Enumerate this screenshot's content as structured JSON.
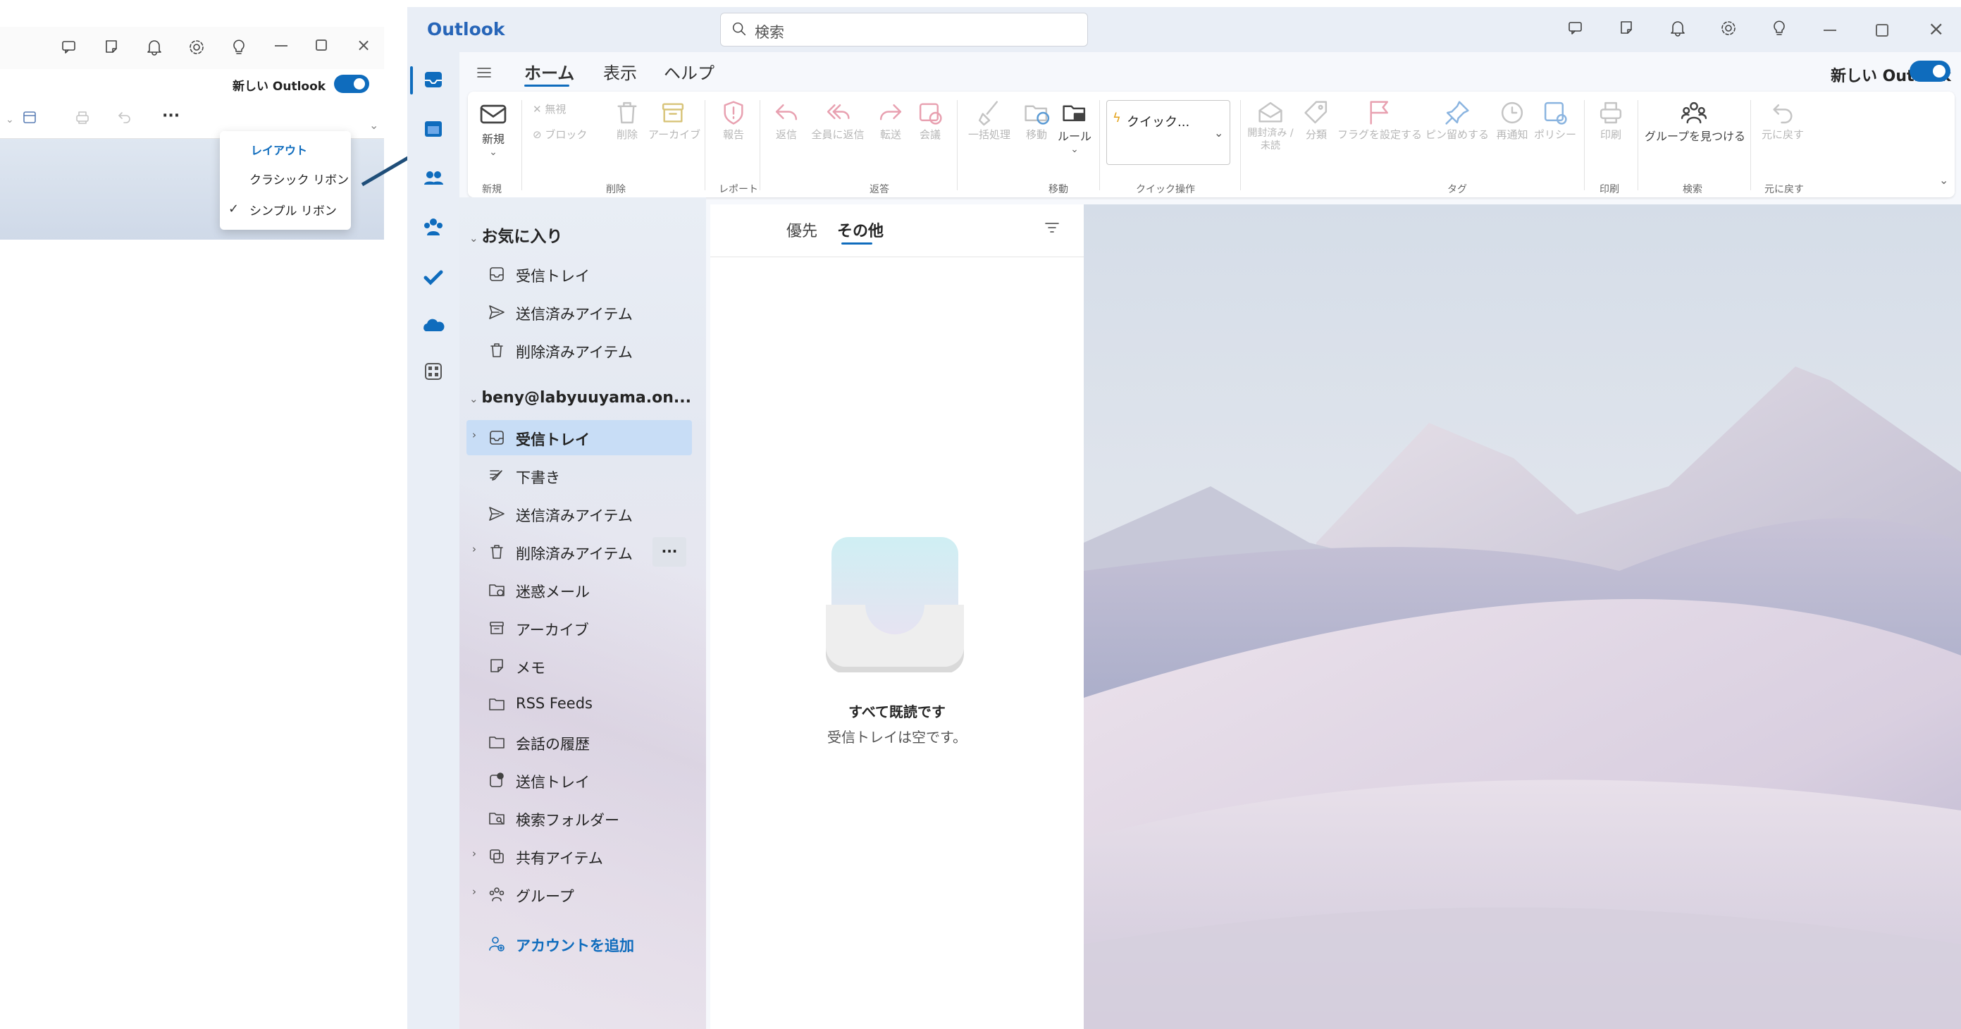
{
  "inset": {
    "toggle_label": "新しい Outlook",
    "more": "···",
    "menu": {
      "header": "レイアウト",
      "items": [
        "クラシック リボン",
        "シンプル リボン"
      ],
      "checked": "シンプル リボン"
    }
  },
  "window": {
    "app_title": "Outlook",
    "search_placeholder": "検索",
    "toggle_label": "新しい Outlook",
    "tabs": [
      "ホーム",
      "表示",
      "ヘルプ"
    ],
    "active_tab": "ホーム"
  },
  "ribbon": {
    "new": "新規",
    "ignore": "無視",
    "block": "ブロック",
    "delete": "削除",
    "archive": "アーカイブ",
    "report": "報告",
    "reply": "返信",
    "reply_all": "全員に返信",
    "forward": "転送",
    "meeting": "会議",
    "sweep": "一括処理",
    "move": "移動",
    "rules": "ルール",
    "quick_steps": "クイック...",
    "read_unread": "開封済み / 未読",
    "categorize": "分類",
    "flag": "フラグを設定する",
    "pin": "ピン留めする",
    "snooze": "再通知",
    "policy": "ポリシー",
    "print": "印刷",
    "find_groups": "グループを見つける",
    "undo": "元に戻す",
    "groups": {
      "new": "新規",
      "delete": "削除",
      "report": "レポート",
      "respond": "返答",
      "move": "移動",
      "quick": "クイック操作",
      "tags": "タグ",
      "print": "印刷",
      "search": "検索",
      "undo": "元に戻す"
    }
  },
  "folders": {
    "favorites_header": "お気に入り",
    "favorites": [
      "受信トレイ",
      "送信済みアイテム",
      "削除済みアイテム"
    ],
    "account": "beny@labyuuyama.on...",
    "account_folders": [
      "受信トレイ",
      "下書き",
      "送信済みアイテム",
      "削除済みアイテム",
      "迷惑メール",
      "アーカイブ",
      "メモ",
      "RSS Feeds",
      "会話の履歴",
      "送信トレイ",
      "検索フォルダー",
      "共有アイテム",
      "グループ"
    ],
    "more_button": "···",
    "add_account": "アカウントを追加"
  },
  "message_list": {
    "tabs": [
      "優先",
      "その他"
    ],
    "active": "その他",
    "empty_title": "すべて既読です",
    "empty_sub": "受信トレイは空です。"
  },
  "colors": {
    "accent": "#0f6cbd",
    "toggle": "#0f6cbd",
    "selected_row": "#c8ddf6",
    "arrow": "#1f4e79"
  }
}
